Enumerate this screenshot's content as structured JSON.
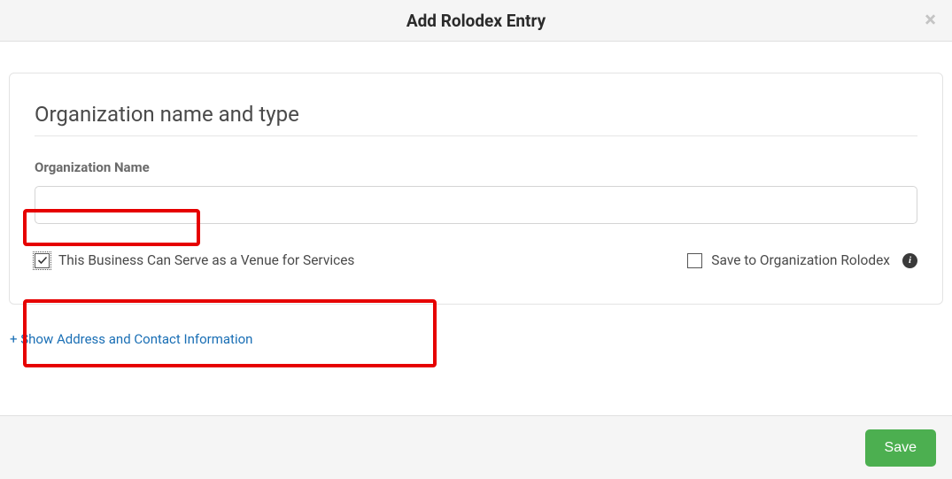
{
  "header": {
    "title": "Add Rolodex Entry"
  },
  "section": {
    "title": "Organization name and type",
    "org_name_label": "Organization Name",
    "org_name_value": "",
    "venue_checkbox_label": "This Business Can Serve as a Venue for Services",
    "venue_checked": true,
    "save_rolodex_label": "Save to Organization Rolodex",
    "save_rolodex_checked": false
  },
  "expand_link": "+ Show Address and Contact Information",
  "footer": {
    "save_label": "Save"
  }
}
